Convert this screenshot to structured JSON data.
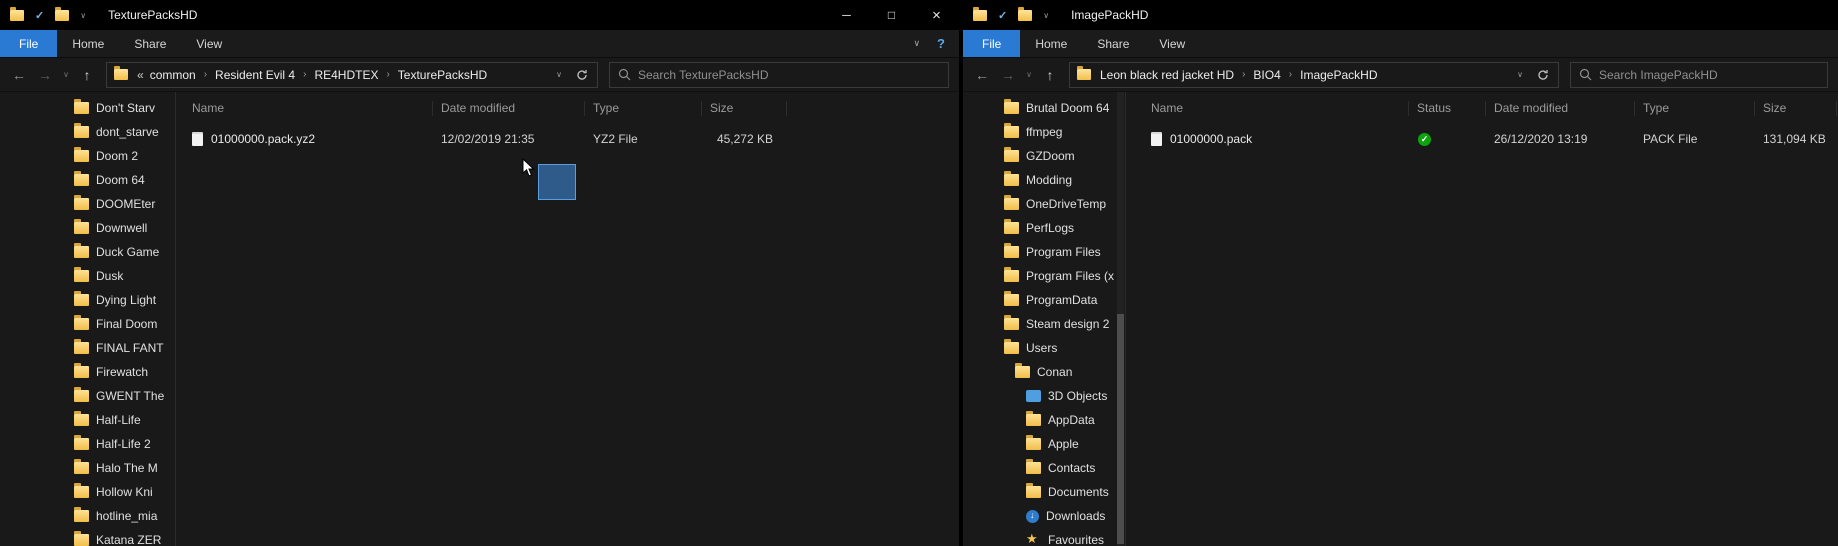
{
  "glyphs": {
    "minimize": "─",
    "maximize": "□",
    "close": "×",
    "back": "←",
    "forward": "→",
    "up": "↑",
    "chevron_down": "∨",
    "help": "?",
    "check": "✓",
    "crumb_sep": "›"
  },
  "left": {
    "title": "TexturePacksHD",
    "tabs": {
      "file": "File",
      "home": "Home",
      "share": "Share",
      "view": "View"
    },
    "breadcrumb": {
      "overflow": "«",
      "segments": [
        "common",
        "Resident Evil 4",
        "RE4HDTEX",
        "TexturePacksHD"
      ]
    },
    "search": {
      "placeholder": "Search TexturePacksHD"
    },
    "sidebar": [
      {
        "label": "Don't Starv",
        "indent": 6,
        "icon": "folder"
      },
      {
        "label": "dont_starve",
        "indent": 6,
        "icon": "folder"
      },
      {
        "label": "Doom 2",
        "indent": 6,
        "icon": "folder"
      },
      {
        "label": "Doom 64",
        "indent": 6,
        "icon": "folder"
      },
      {
        "label": "DOOMEter",
        "indent": 6,
        "icon": "folder"
      },
      {
        "label": "Downwell",
        "indent": 6,
        "icon": "folder"
      },
      {
        "label": "Duck Game",
        "indent": 6,
        "icon": "folder"
      },
      {
        "label": "Dusk",
        "indent": 6,
        "icon": "folder"
      },
      {
        "label": "Dying Light",
        "indent": 6,
        "icon": "folder"
      },
      {
        "label": "Final Doom",
        "indent": 6,
        "icon": "folder"
      },
      {
        "label": "FINAL FANT",
        "indent": 6,
        "icon": "folder"
      },
      {
        "label": "Firewatch",
        "indent": 6,
        "icon": "folder"
      },
      {
        "label": "GWENT The",
        "indent": 6,
        "icon": "folder"
      },
      {
        "label": "Half-Life",
        "indent": 6,
        "icon": "folder"
      },
      {
        "label": "Half-Life 2",
        "indent": 6,
        "icon": "folder"
      },
      {
        "label": "Halo The M",
        "indent": 6,
        "icon": "folder"
      },
      {
        "label": "Hollow Kni",
        "indent": 6,
        "icon": "folder"
      },
      {
        "label": "hotline_mia",
        "indent": 6,
        "icon": "folder"
      },
      {
        "label": "Katana ZER",
        "indent": 6,
        "icon": "folder"
      }
    ],
    "columns": {
      "name": "Name",
      "date": "Date modified",
      "type": "Type",
      "size": "Size"
    },
    "file": {
      "name": "01000000.pack.yz2",
      "date": "12/02/2019 21:35",
      "type": "YZ2 File",
      "size": "45,272 KB"
    }
  },
  "right": {
    "title": "ImagePackHD",
    "tabs": {
      "file": "File",
      "home": "Home",
      "share": "Share",
      "view": "View"
    },
    "breadcrumb": {
      "segments": [
        "Leon black red jacket HD",
        "BIO4",
        "ImagePackHD"
      ]
    },
    "search": {
      "placeholder": "Search ImagePackHD"
    },
    "sidebar": [
      {
        "label": "Brutal Doom 64",
        "indent": 3,
        "icon": "folder"
      },
      {
        "label": "ffmpeg",
        "indent": 3,
        "icon": "folder"
      },
      {
        "label": "GZDoom",
        "indent": 3,
        "icon": "folder"
      },
      {
        "label": "Modding",
        "indent": 3,
        "icon": "folder"
      },
      {
        "label": "OneDriveTemp",
        "indent": 3,
        "icon": "folder"
      },
      {
        "label": "PerfLogs",
        "indent": 3,
        "icon": "folder"
      },
      {
        "label": "Program Files",
        "indent": 3,
        "icon": "folder"
      },
      {
        "label": "Program Files (x",
        "indent": 3,
        "icon": "folder"
      },
      {
        "label": "ProgramData",
        "indent": 3,
        "icon": "folder"
      },
      {
        "label": "Steam design 2",
        "indent": 3,
        "icon": "folder"
      },
      {
        "label": "Users",
        "indent": 3,
        "icon": "folder"
      },
      {
        "label": "Conan",
        "indent": 4,
        "icon": "folder"
      },
      {
        "label": "3D Objects",
        "indent": 5,
        "icon": "cube"
      },
      {
        "label": "AppData",
        "indent": 5,
        "icon": "folder"
      },
      {
        "label": "Apple",
        "indent": 5,
        "icon": "folder"
      },
      {
        "label": "Contacts",
        "indent": 5,
        "icon": "folder"
      },
      {
        "label": "Documents",
        "indent": 5,
        "icon": "folder"
      },
      {
        "label": "Downloads",
        "indent": 5,
        "icon": "download"
      },
      {
        "label": "Favourites",
        "indent": 5,
        "icon": "star"
      }
    ],
    "columns": {
      "name": "Name",
      "status": "Status",
      "date": "Date modified",
      "type": "Type",
      "size": "Size"
    },
    "file": {
      "name": "01000000.pack",
      "date": "26/12/2020 13:19",
      "type": "PACK File",
      "size": "131,094 KB"
    }
  }
}
